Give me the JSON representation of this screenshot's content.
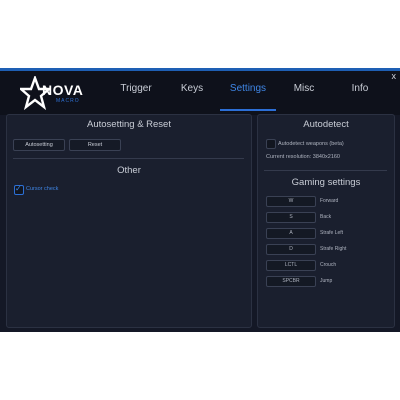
{
  "window": {
    "close_label": "x"
  },
  "logo": {
    "brand": "NOVA",
    "sub": "MACRO"
  },
  "tabs": [
    {
      "label": "Trigger"
    },
    {
      "label": "Keys"
    },
    {
      "label": "Settings"
    },
    {
      "label": "Misc"
    },
    {
      "label": "Info"
    }
  ],
  "active_tab": "Settings",
  "left_panel": {
    "title": "Autosetting & Reset",
    "autosetting_label": "Autosetting",
    "reset_label": "Reset",
    "other_title": "Other",
    "cursor_check_label": "Cursor check",
    "cursor_check_checked": true
  },
  "right_panel": {
    "title": "Autodetect",
    "autodetect_label": "Autodetect weapons (beta)",
    "autodetect_checked": false,
    "resolution_text": "Current resolution: 3840x2160",
    "gaming_title": "Gaming settings",
    "keys": [
      {
        "key": "W",
        "action": "Forward"
      },
      {
        "key": "S",
        "action": "Back"
      },
      {
        "key": "A",
        "action": "Strafe Left"
      },
      {
        "key": "D",
        "action": "Strafe Right"
      },
      {
        "key": "LCTL",
        "action": "Crouch"
      },
      {
        "key": "SPCBR",
        "action": "Jump"
      }
    ]
  },
  "colors": {
    "accent": "#2c6fd6",
    "background": "#141826",
    "panel": "#1a1f2e"
  }
}
